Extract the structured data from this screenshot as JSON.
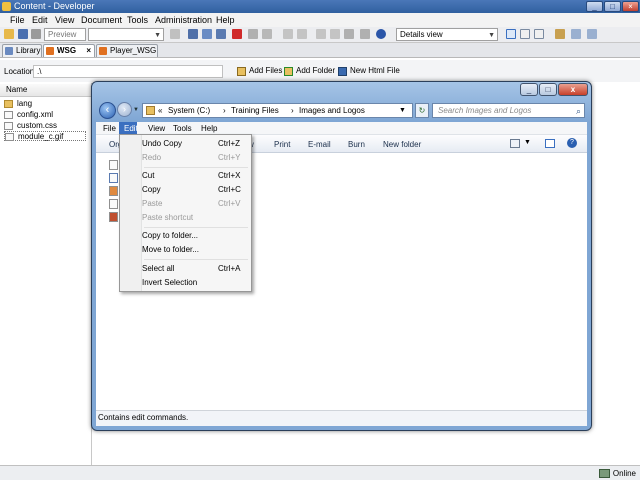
{
  "app": {
    "title": "Content - Developer",
    "menu": [
      "File",
      "Edit",
      "View",
      "Document",
      "Tools",
      "Administration",
      "Help"
    ],
    "toolbar": {
      "preview_label": "Preview",
      "view_combo": "Details view"
    },
    "window_controls": [
      "_",
      "□",
      "×"
    ]
  },
  "tabs": [
    {
      "label": "Library",
      "active": false
    },
    {
      "label": "WSG",
      "active": true,
      "close": "×"
    },
    {
      "label": "Player_WSG",
      "active": false
    }
  ],
  "location": {
    "label": "Location:",
    "value": ".\\",
    "actions": [
      "Add Files",
      "Add Folder",
      "New Html File"
    ]
  },
  "file_pane": {
    "header": "Name",
    "items": [
      {
        "name": "lang",
        "icon": "folder-icon"
      },
      {
        "name": "config.xml",
        "icon": "file-icon"
      },
      {
        "name": "custom.css",
        "icon": "file-icon"
      },
      {
        "name": "module_c.gif",
        "icon": "image-file-icon"
      }
    ]
  },
  "status": {
    "online": "Online"
  },
  "explorer": {
    "controls": [
      "_",
      "□",
      "x"
    ],
    "address": [
      "«",
      "System (C:)",
      "›",
      "Training Files",
      "›",
      "Images and Logos"
    ],
    "search_placeholder": "Search Images and Logos",
    "menu": [
      "File",
      "Edit",
      "View",
      "Tools",
      "Help"
    ],
    "commands": [
      "Org",
      "w",
      "Print",
      "E-mail",
      "Burn",
      "New folder"
    ],
    "status": "Contains edit commands."
  },
  "edit_menu": {
    "items": [
      {
        "label": "Undo Copy",
        "shortcut": "Ctrl+Z",
        "disabled": false
      },
      {
        "label": "Redo",
        "shortcut": "Ctrl+Y",
        "disabled": true
      },
      {
        "label": "Cut",
        "shortcut": "Ctrl+X",
        "disabled": false
      },
      {
        "label": "Copy",
        "shortcut": "Ctrl+C",
        "disabled": false
      },
      {
        "label": "Paste",
        "shortcut": "Ctrl+V",
        "disabled": true
      },
      {
        "label": "Paste shortcut",
        "shortcut": "",
        "disabled": true
      },
      {
        "label": "Copy to folder...",
        "shortcut": "",
        "disabled": false
      },
      {
        "label": "Move to folder...",
        "shortcut": "",
        "disabled": false
      },
      {
        "label": "Select all",
        "shortcut": "Ctrl+A",
        "disabled": false
      },
      {
        "label": "Invert Selection",
        "shortcut": "",
        "disabled": false
      }
    ]
  },
  "colors": {
    "accent": "#3a6fc0",
    "titlebar": "#3a6aac",
    "frame": "#7fa6d4"
  }
}
